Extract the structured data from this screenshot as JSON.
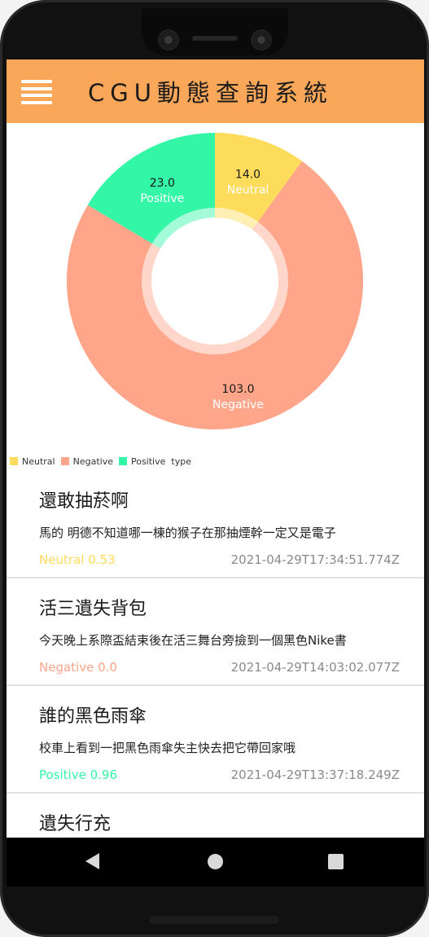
{
  "app": {
    "title": "CGU動態查詢系統"
  },
  "colors": {
    "appbar": "#fba75a",
    "neutral": "#fddb5b",
    "negative": "#ffa58a",
    "positive": "#34f6a7",
    "date": "#8a8a8a"
  },
  "chart_data": {
    "type": "pie",
    "donut": true,
    "slices": [
      {
        "label": "Neutral",
        "value": 14.0,
        "value_text": "14.0",
        "color": "#fddb5b"
      },
      {
        "label": "Negative",
        "value": 103.0,
        "value_text": "103.0",
        "color": "#ffa58a"
      },
      {
        "label": "Positive",
        "value": 23.0,
        "value_text": "23.0",
        "color": "#34f6a7"
      }
    ],
    "legend": [
      "Neutral",
      "Negative",
      "Positive"
    ],
    "legend_title": "type",
    "legend_position": "bottom-left"
  },
  "posts": [
    {
      "title": "還敢抽菸啊",
      "content": "馬的 明德不知道哪一棟的猴子在那抽煙幹一定又是電子",
      "sentiment": "Neutral 0.53",
      "kind": "neutral",
      "date": "2021-04-29T17:34:51.774Z"
    },
    {
      "title": "活三遺失背包",
      "content": "今天晚上系際盃結束後在活三舞台旁撿到一個黑色Nike書",
      "sentiment": "Negative 0.0",
      "kind": "negative",
      "date": "2021-04-29T14:03:02.077Z"
    },
    {
      "title": "誰的黑色雨傘",
      "content": "校車上看到一把黑色雨傘失主快去把它帶回家哦",
      "sentiment": "Positive 0.96",
      "kind": "positive",
      "date": "2021-04-29T13:37:18.249Z"
    },
    {
      "title": "遺失行充",
      "content": "",
      "sentiment": "",
      "kind": "neutral",
      "date": ""
    }
  ],
  "nav": {
    "back": "back",
    "home": "home",
    "recent": "recent-apps"
  }
}
